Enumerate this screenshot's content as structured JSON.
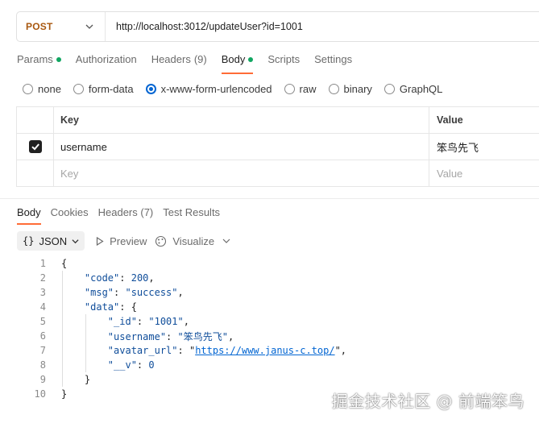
{
  "request": {
    "method": "POST",
    "url": "http://localhost:3012/updateUser?id=1001"
  },
  "request_tabs": [
    {
      "label": "Params",
      "dot": true,
      "active": false
    },
    {
      "label": "Authorization",
      "active": false
    },
    {
      "label": "Headers",
      "count": "(9)",
      "active": false
    },
    {
      "label": "Body",
      "dot": true,
      "active": true
    },
    {
      "label": "Scripts",
      "active": false
    },
    {
      "label": "Settings",
      "active": false
    }
  ],
  "body_types": [
    {
      "label": "none",
      "selected": false
    },
    {
      "label": "form-data",
      "selected": false
    },
    {
      "label": "x-www-form-urlencoded",
      "selected": true
    },
    {
      "label": "raw",
      "selected": false
    },
    {
      "label": "binary",
      "selected": false
    },
    {
      "label": "GraphQL",
      "selected": false
    }
  ],
  "kv_table": {
    "headers": {
      "key": "Key",
      "value": "Value"
    },
    "rows": [
      {
        "checked": true,
        "key": "username",
        "value": "笨鸟先飞"
      }
    ],
    "placeholder": {
      "key": "Key",
      "value": "Value"
    }
  },
  "response_tabs": [
    {
      "label": "Body",
      "active": true
    },
    {
      "label": "Cookies",
      "active": false
    },
    {
      "label": "Headers (7)",
      "active": false
    },
    {
      "label": "Test Results",
      "active": false
    }
  ],
  "response_toolbar": {
    "format_icon": "{}",
    "format_label": "JSON",
    "preview_label": "Preview",
    "visualize_label": "Visualize"
  },
  "code_lines": [
    "1",
    "2",
    "3",
    "4",
    "5",
    "6",
    "7",
    "8",
    "9",
    "10"
  ],
  "response_json": {
    "open_brace": "{",
    "close_brace": "}",
    "code_key": "\"code\"",
    "code_val": "200",
    "msg_key": "\"msg\"",
    "msg_val": "\"success\"",
    "data_key": "\"data\"",
    "id_key": "\"_id\"",
    "id_val": "\"1001\"",
    "username_key": "\"username\"",
    "username_val": "\"笨鸟先飞\"",
    "avatar_key": "\"avatar_url\"",
    "avatar_val": "https://www.janus-c.top/",
    "v_key": "\"__v\"",
    "v_val": "0"
  },
  "watermark": "掘金技术社区 @ 前端笨鸟",
  "colors": {
    "method": "#a8570f",
    "accent": "#ff6c37",
    "dot": "#10a661",
    "radio_selected": "#0265d2",
    "json_key": "#0f4d9a"
  },
  "icons": [
    "chevron-down-icon",
    "checkbox-checked-icon",
    "play-icon",
    "visualize-icon"
  ]
}
